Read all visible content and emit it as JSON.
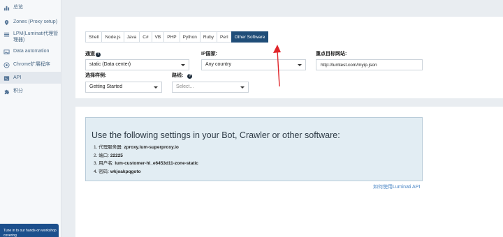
{
  "sidebar": {
    "items": [
      {
        "label": "总览",
        "icon": "bar-chart-icon"
      },
      {
        "label": "Zones (Proxy setup)",
        "icon": "location-pin-icon"
      },
      {
        "label": "LPM(Luminati代理管理器)",
        "icon": "list-icon"
      },
      {
        "label": "Data automation",
        "icon": "image-icon"
      },
      {
        "label": "Chrome扩展程序",
        "icon": "chrome-icon"
      },
      {
        "label": "API",
        "icon": "api-icon"
      },
      {
        "label": "积分",
        "icon": "puzzle-icon"
      }
    ],
    "promo": "Tune in to our hands-on workshop covering"
  },
  "tabs": [
    "Shell",
    "Node.js",
    "Java",
    "C#",
    "VB",
    "PHP",
    "Python",
    "Ruby",
    "Perl",
    "Other Software"
  ],
  "active_tab": "Other Software",
  "form": {
    "channel_label": "通道",
    "channel_value": "static (Data center)",
    "country_label": "IP国家:",
    "country_value": "Any country",
    "target_label": "重点目标网站:",
    "target_value": "http://lumtest.com/myip.json",
    "example_label": "选择样例:",
    "example_value": "Getting Started",
    "route_label": "路线:",
    "route_placeholder": "Select..."
  },
  "settings": {
    "title": "Use the following settings in your Bot, Crawler or other software:",
    "items": [
      {
        "label": "1. 代理服务器: ",
        "value": "zproxy.lum-superproxy.io"
      },
      {
        "label": "2. 端口: ",
        "value": "22225"
      },
      {
        "label": "3. 用户名: ",
        "value": "lum-customer-hl_e6453d11-zone-static"
      },
      {
        "label": "4. 密码: ",
        "value": "wkjoakpqgoto"
      }
    ],
    "howto_link": "如何使用Luminati API"
  },
  "colors": {
    "accent": "#1f4d78",
    "link": "#4a86c5",
    "arrow": "#e0262b",
    "panel": "#e2edf3"
  }
}
